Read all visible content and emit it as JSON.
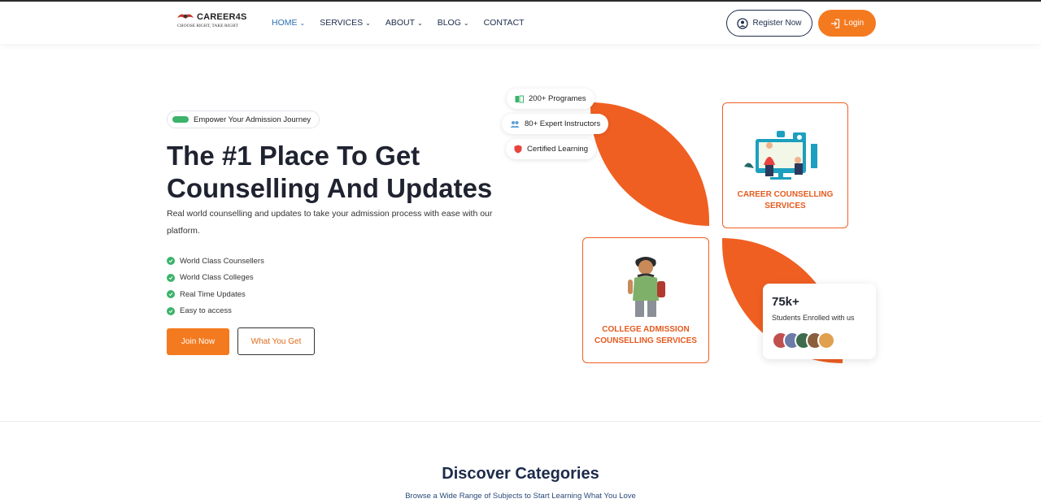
{
  "header": {
    "logo_name": "CAREER4S",
    "logo_tagline": "CHOOSE RIGHT, TAKE RIGHT",
    "nav": [
      {
        "label": "HOME",
        "active": true,
        "has_dropdown": true
      },
      {
        "label": "SERVICES",
        "active": false,
        "has_dropdown": true
      },
      {
        "label": "ABOUT",
        "active": false,
        "has_dropdown": true
      },
      {
        "label": "BLOG",
        "active": false,
        "has_dropdown": true
      },
      {
        "label": "CONTACT",
        "active": false,
        "has_dropdown": false
      }
    ],
    "register_label": "Register Now",
    "login_label": "Login"
  },
  "hero": {
    "pill": "Empower Your Admission Journey",
    "title_line1": "The #1 Place To Get",
    "title_line2": "Counselling And Updates",
    "subtitle": "Real world counselling and updates to take your admission process with ease with our platform.",
    "features": [
      "World Class Counsellers",
      "World Class Colleges",
      "Real Time Updates",
      "Easy to access"
    ],
    "join_label": "Join Now",
    "what_label": "What You Get"
  },
  "visual": {
    "chips": [
      {
        "label": "200+ Programes",
        "icon": "book-icon"
      },
      {
        "label": "80+ Expert Instructors",
        "icon": "users-icon"
      },
      {
        "label": "Certified Learning",
        "icon": "shield-icon"
      }
    ],
    "card_career": "CAREER COUNSELLING SERVICES",
    "card_college": "COLLEGE ADMISSION COUNSELLING SERVICES",
    "stat_value": "75k+",
    "stat_label": "Students Enrolled with us"
  },
  "categories": {
    "title": "Discover Categories",
    "subtitle": "Browse a Wide Range of Subjects to Start Learning What You Love"
  },
  "colors": {
    "accent": "#f47a20",
    "leaf": "#f05f22",
    "navy": "#1c2b4a",
    "success": "#3bb36b"
  }
}
